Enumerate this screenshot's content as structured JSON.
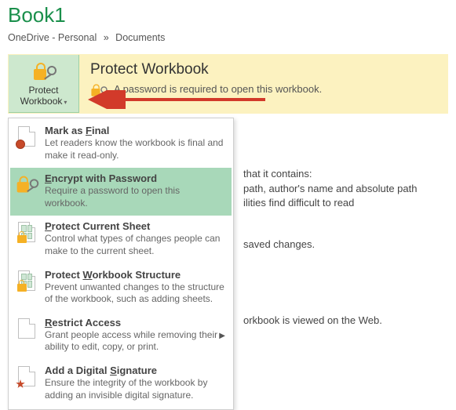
{
  "title": "Book1",
  "breadcrumb": {
    "root": "OneDrive - Personal",
    "sep": "»",
    "leaf": "Documents"
  },
  "protect": {
    "button_line1": "Protect",
    "button_line2": "Workbook",
    "heading": "Protect Workbook",
    "desc": "A password is required to open this workbook."
  },
  "menu": {
    "mark_final": {
      "title_pre": "Mark as ",
      "title_ul": "F",
      "title_post": "inal",
      "body": "Let readers know the workbook is final and make it read-only."
    },
    "encrypt": {
      "title_pre": "",
      "title_ul": "E",
      "title_post": "ncrypt with Password",
      "body": "Require a password to open this workbook."
    },
    "protect_sheet": {
      "title_pre": "",
      "title_ul": "P",
      "title_post": "rotect Current Sheet",
      "body": "Control what types of changes people can make to the current sheet."
    },
    "protect_structure": {
      "title_pre": "Protect ",
      "title_ul": "W",
      "title_post": "orkbook Structure",
      "body": "Prevent unwanted changes to the structure of the workbook, such as adding sheets."
    },
    "restrict": {
      "title_pre": "",
      "title_ul": "R",
      "title_post": "estrict Access",
      "body": "Grant people access while removing their ability to edit, copy, or print."
    },
    "sign": {
      "title_pre": "Add a Digital ",
      "title_ul": "S",
      "title_post": "ignature",
      "body": "Ensure the integrity of the workbook by adding an invisible digital signature."
    }
  },
  "bg": {
    "line1": "that it contains:",
    "line2": "path, author's name and absolute path",
    "line3": "ilities find difficult to read",
    "line4": "saved changes.",
    "line5": "orkbook is viewed on the Web."
  }
}
